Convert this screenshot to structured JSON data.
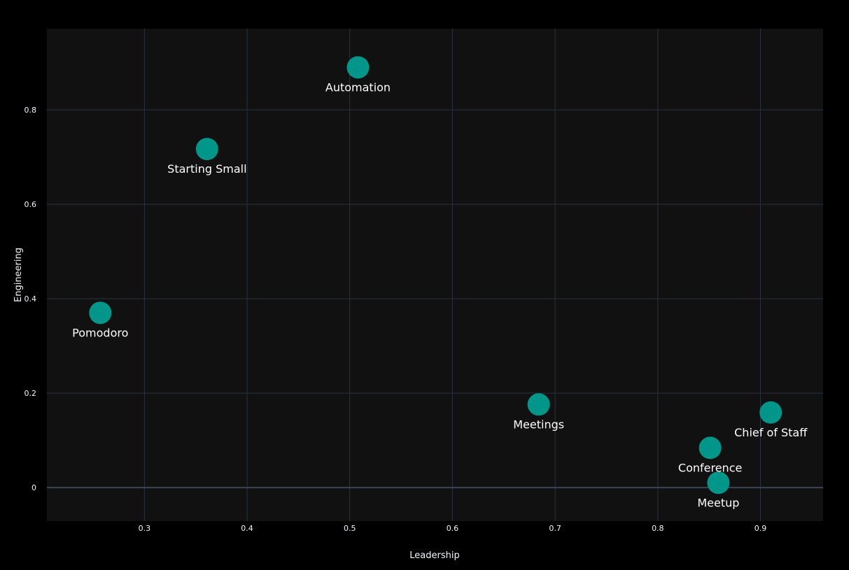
{
  "chart_data": {
    "type": "scatter",
    "title": "",
    "xlabel": "Leadership",
    "ylabel": "Engineering",
    "xlim": [
      0.205,
      0.961
    ],
    "ylim": [
      -0.071,
      0.972
    ],
    "x_ticks": [
      0.3,
      0.4,
      0.5,
      0.6,
      0.7,
      0.8,
      0.9
    ],
    "x_tick_labels": [
      "0.3",
      "0.4",
      "0.5",
      "0.6",
      "0.7",
      "0.8",
      "0.9"
    ],
    "y_ticks": [
      0,
      0.2,
      0.4,
      0.6,
      0.8
    ],
    "y_tick_labels": [
      "0",
      "0.2",
      "0.4",
      "0.6",
      "0.8"
    ],
    "grid": true,
    "legend": "none",
    "colors": {
      "page_bg": "#000000",
      "plot_bg": "#111111",
      "grid": "#283442",
      "zero_line": "#3a4657",
      "marker": "#00968a",
      "text": "#f2f5fa"
    },
    "points": [
      {
        "label": "Automation",
        "x": 0.508,
        "y": 0.89
      },
      {
        "label": "Starting Small",
        "x": 0.361,
        "y": 0.717
      },
      {
        "label": "Pomodoro",
        "x": 0.257,
        "y": 0.37
      },
      {
        "label": "Meetings",
        "x": 0.684,
        "y": 0.176
      },
      {
        "label": "Chief of Staff",
        "x": 0.91,
        "y": 0.159
      },
      {
        "label": "Conference",
        "x": 0.851,
        "y": 0.084
      },
      {
        "label": "Meetup",
        "x": 0.859,
        "y": 0.01
      }
    ]
  }
}
